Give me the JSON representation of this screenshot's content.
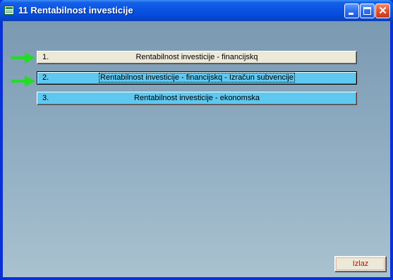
{
  "window": {
    "title": "11 Rentabilnost investicije",
    "buttons": {
      "minimize": "minimize",
      "maximize": "maximize",
      "close": "close"
    }
  },
  "menu": {
    "items": [
      {
        "number": "1.",
        "label": "Rentabilnost investicije - financijskq",
        "style": "gray",
        "arrow": true,
        "focused": false
      },
      {
        "number": "2.",
        "label": "Rentabilnost investicije - financijskq - Izračun subvencije",
        "style": "blue",
        "arrow": true,
        "focused": true
      },
      {
        "number": "3.",
        "label": "Rentabilnost investicije - ekonomska",
        "style": "blue",
        "arrow": false,
        "focused": false
      }
    ]
  },
  "exit_button": {
    "label": "Izlaz"
  },
  "colors": {
    "titlebar": "#0a54e3",
    "button_gray": "#ece9d8",
    "button_blue": "#5ec8f0",
    "arrow_green": "#22dd22",
    "exit_text": "#e00000"
  }
}
